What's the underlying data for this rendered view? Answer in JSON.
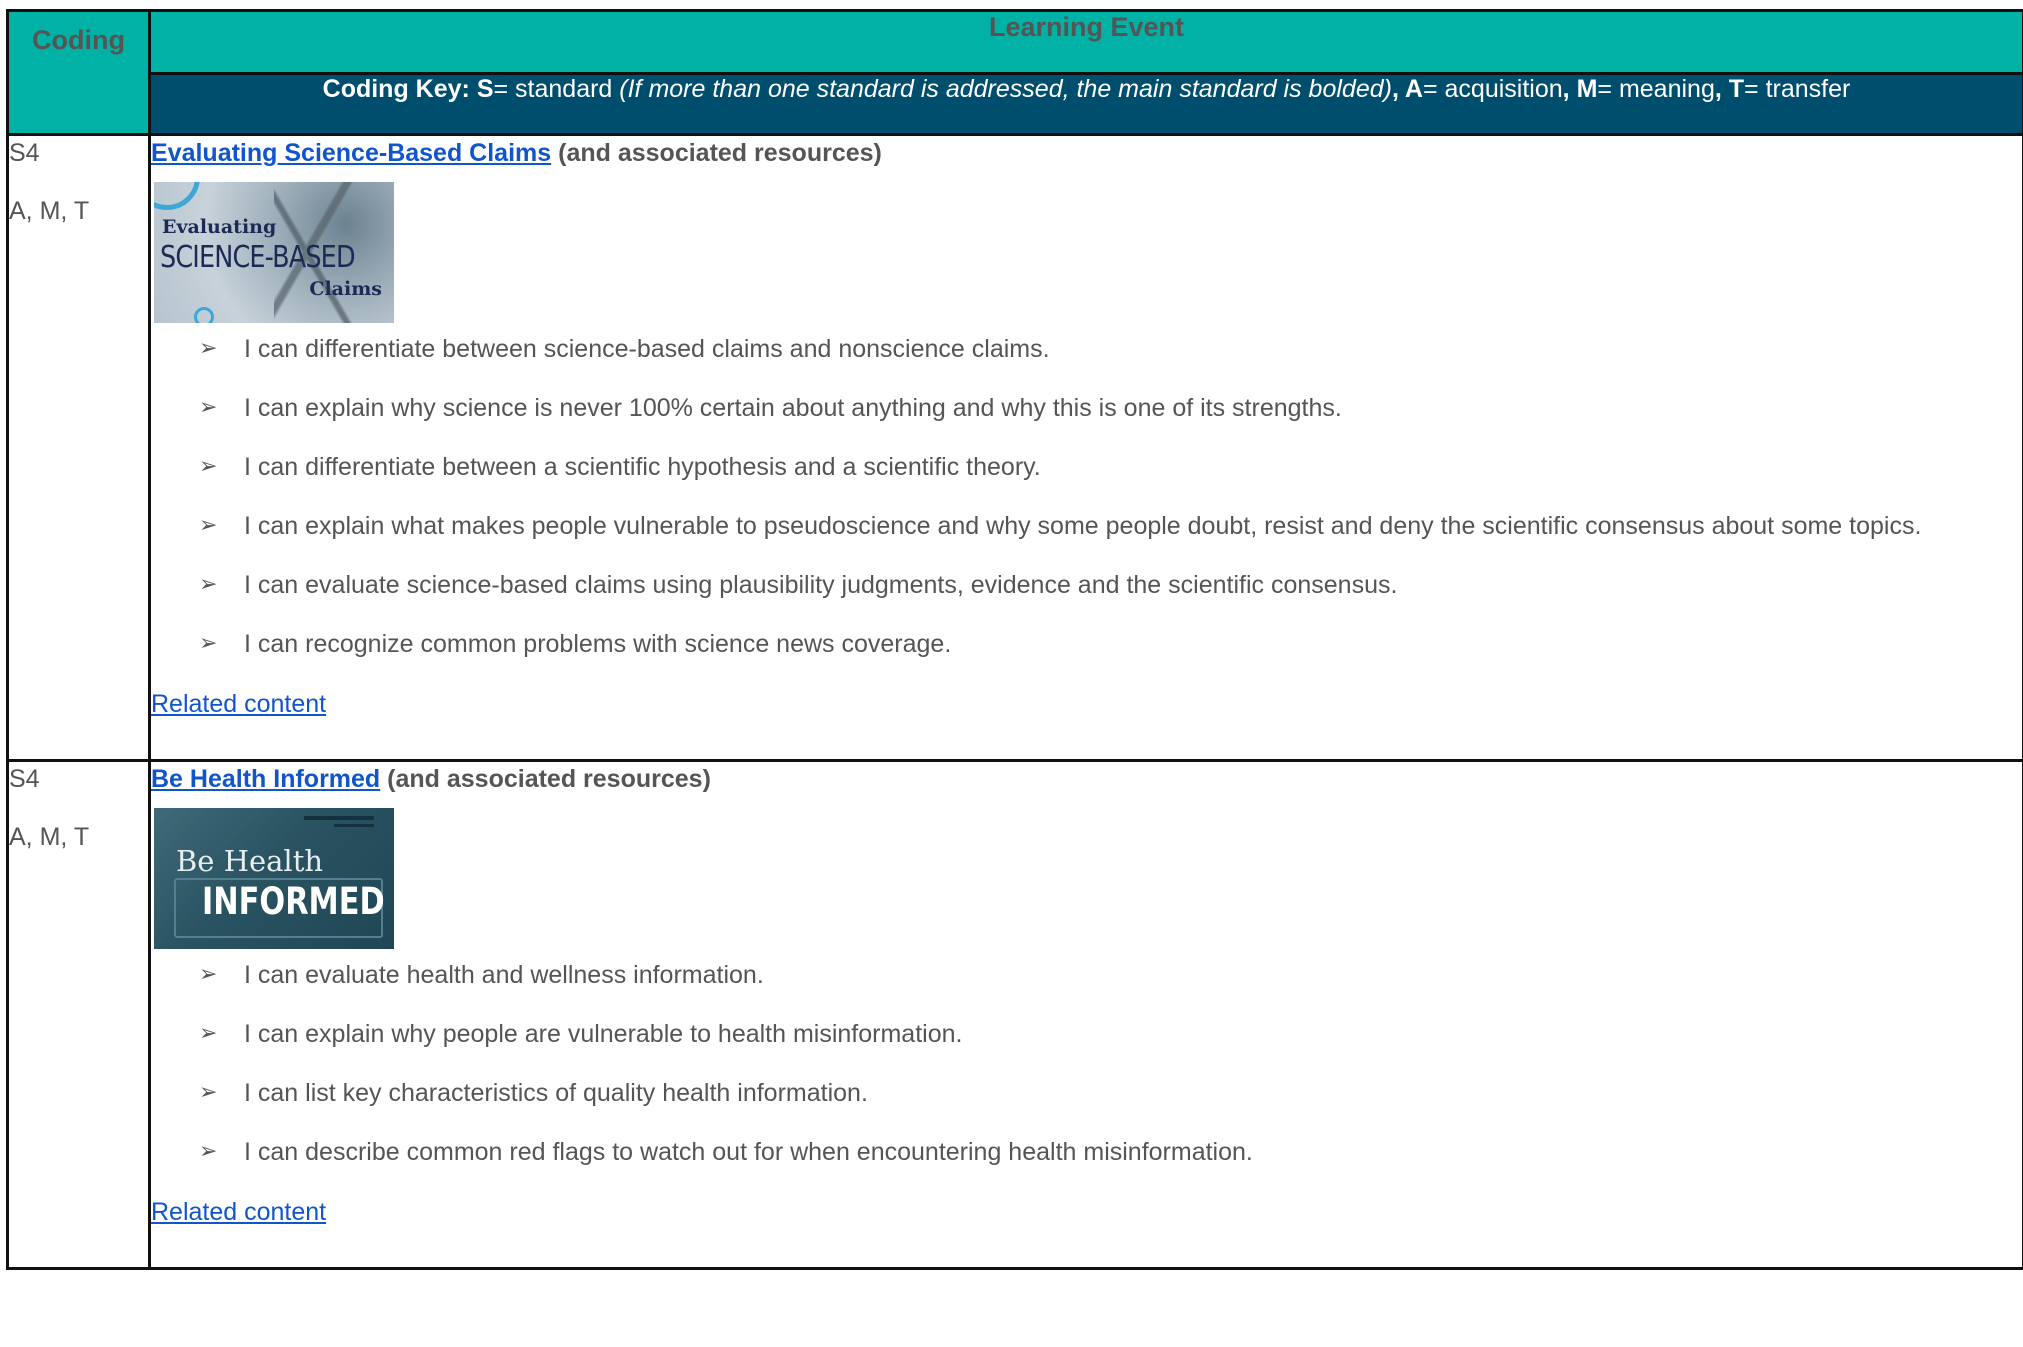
{
  "header": {
    "coding_label": "Coding",
    "event_label": "Learning Event"
  },
  "key": {
    "label": "Coding Key:",
    "s_letter": "S",
    "s_text": "= standard ",
    "s_note": "(If more than one standard is addressed, the main standard is bolded)",
    "sep1": ", ",
    "a_letter": "A",
    "a_text": "= acquisition",
    "sep2": ", ",
    "m_letter": "M",
    "m_text": "= meaning",
    "sep3": ", ",
    "t_letter": "T",
    "t_text": "= transfer"
  },
  "rows": [
    {
      "standard": "S4",
      "codes": "A, M, T",
      "title_link": "Evaluating Science-Based Claims",
      "title_suffix": " (and associated resources)",
      "thumbnail": {
        "line1": "Evaluating",
        "line2": "SCIENCE-BASED",
        "line3": "Claims"
      },
      "items": [
        "I can differentiate between science-based claims and nonscience claims.",
        "I can explain why science is never 100% certain about anything and why this is one of its strengths.",
        "I can differentiate between a scientific hypothesis and a scientific theory.",
        "I can explain what makes people vulnerable to pseudoscience and why some people doubt, resist and deny the scientific consensus about some topics.",
        "I can evaluate science-based claims using plausibility judgments, evidence and the scientific consensus.",
        "I can recognize common problems with science news coverage."
      ],
      "related": "Related content"
    },
    {
      "standard": "S4",
      "codes": "A, M, T",
      "title_link": "Be Health Informed",
      "title_suffix": " (and associated resources)",
      "thumbnail": {
        "line1": "Be Health",
        "line2": "INFORMED"
      },
      "items": [
        "I can evaluate health and wellness information.",
        "I can explain why people are vulnerable to health misinformation.",
        "I can list key characteristics of quality health information.",
        "I can describe common red flags to watch out for when encountering health misinformation."
      ],
      "related": "Related content"
    }
  ],
  "bullet_glyph": "➢",
  "colors": {
    "header_bg": "#00b1a6",
    "key_bg": "#004e6d",
    "link": "#1155cc",
    "text": "#555555",
    "border": "#111111"
  }
}
